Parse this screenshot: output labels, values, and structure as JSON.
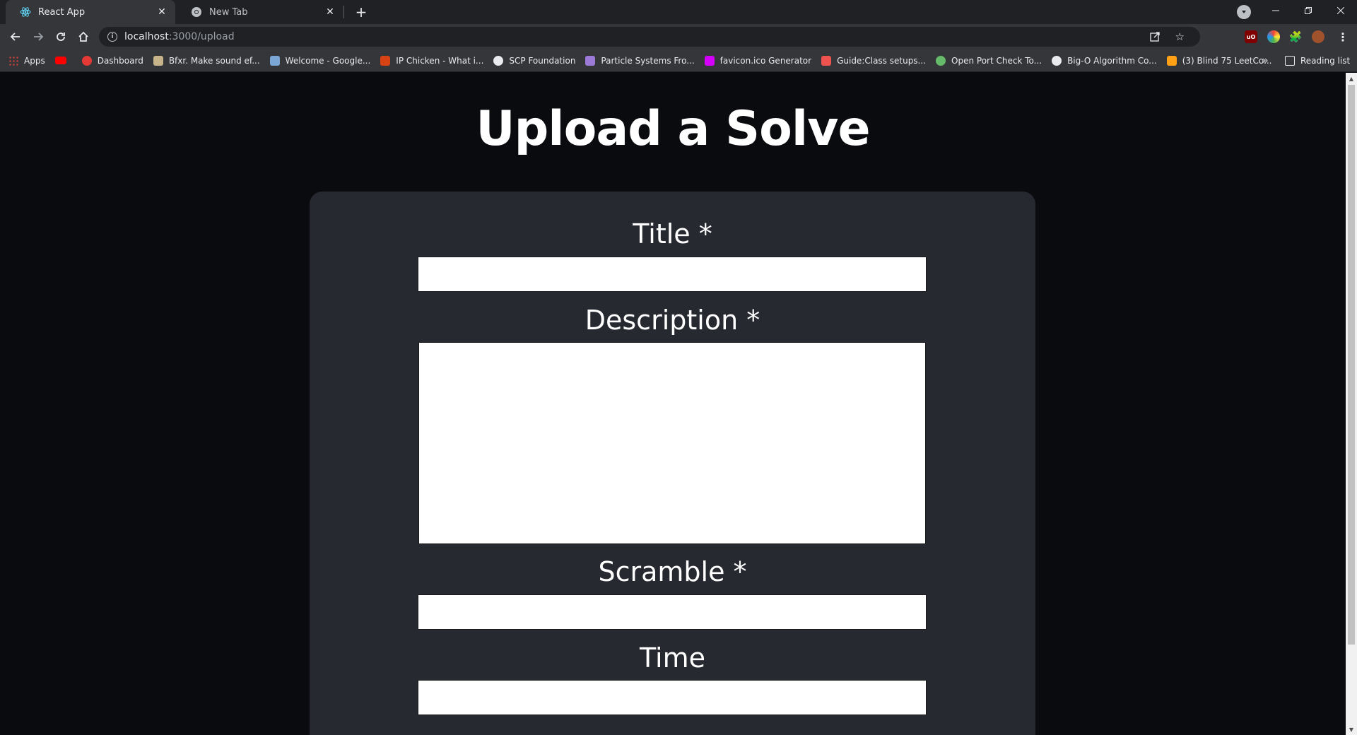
{
  "browser": {
    "tabs": [
      {
        "title": "React App",
        "icon": "react-icon",
        "active": true
      },
      {
        "title": "New Tab",
        "icon": "chrome-icon",
        "active": false
      }
    ],
    "new_tab_label": "+",
    "url_host": "localhost",
    "url_path": ":3000/upload",
    "bookmarks": [
      {
        "label": "Apps",
        "icon": "apps-grid-icon",
        "color": "#4285f4"
      },
      {
        "label": "",
        "icon": "youtube-icon",
        "color": "#ff0000"
      },
      {
        "label": "Dashboard",
        "icon": "dashboard-icon",
        "color": "#e53935"
      },
      {
        "label": "Bfxr. Make sound ef...",
        "icon": "bfxr-icon",
        "color": "#c8b48a"
      },
      {
        "label": "Welcome - Google...",
        "icon": "google-icon",
        "color": "#7aa7d6"
      },
      {
        "label": "IP Chicken - What i...",
        "icon": "chicken-icon",
        "color": "#d84315"
      },
      {
        "label": "SCP Foundation",
        "icon": "scp-icon",
        "color": "#e8eaed"
      },
      {
        "label": "Particle Systems Fro...",
        "icon": "particle-icon",
        "color": "#9c7bd8"
      },
      {
        "label": "favicon.ico Generator",
        "icon": "favicon-generator-icon",
        "color": "#d500f9"
      },
      {
        "label": "Guide:Class setups...",
        "icon": "guide-icon",
        "color": "#ef5350"
      },
      {
        "label": "Open Port Check To...",
        "icon": "globe-icon",
        "color": "#66bb6a"
      },
      {
        "label": "Big-O Algorithm Co...",
        "icon": "bigo-icon",
        "color": "#e8eaed"
      },
      {
        "label": "(3) Blind 75 LeetCo...",
        "icon": "leetcode-icon",
        "color": "#ffa116"
      }
    ],
    "overflow_label": "»",
    "reading_list_label": "Reading list"
  },
  "page": {
    "title": "Upload a Solve",
    "form": {
      "title_label": "Title *",
      "title_value": "",
      "description_label": "Description *",
      "description_value": "",
      "scramble_label": "Scramble *",
      "scramble_value": "",
      "time_label": "Time",
      "time_value": ""
    }
  },
  "colors": {
    "page_bg": "#0a0b0e",
    "card_bg": "#272931",
    "tabstrip_bg": "#202124",
    "toolbar_bg": "#35363a"
  }
}
